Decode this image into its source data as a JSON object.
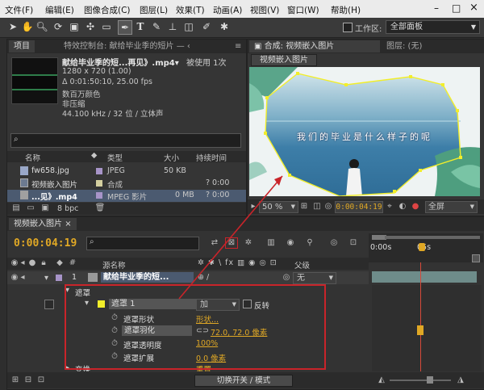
{
  "menu": [
    "文件(F)",
    "编辑(E)",
    "图像合成(C)",
    "图层(L)",
    "效果(T)",
    "动画(A)",
    "视图(V)",
    "窗口(W)",
    "帮助(H)"
  ],
  "window_controls": {
    "minimize": "–",
    "maximize": "□",
    "close": "×"
  },
  "toolbar": {
    "workspace_label": "工作区:",
    "workspace_value": "全部面板"
  },
  "project_panel": {
    "tab_project": "项目",
    "tab_effects": "特效控制台: 献给毕业季的短片 — ‹",
    "file_title": "献给毕业季的短...再见》.mp4▾",
    "used_count": "被使用 1次",
    "resolution": "1280 x 720 (1.00)",
    "duration": "Δ 0:01:50:10, 25.00 fps",
    "colors": "数百万颜色",
    "compression": "非压缩",
    "audio": "44.100 kHz / 32 位 / 立体声",
    "search_placeholder": "",
    "col_name": "名称",
    "col_type": "类型",
    "col_size": "大小",
    "col_duration": "持续时间",
    "items": [
      {
        "name": "fw658.jpg",
        "type": "JPEG",
        "size": "50 KB",
        "duration": ""
      },
      {
        "name": "视频嵌入图片",
        "type": "合成",
        "size": "",
        "duration": "? 0:00"
      },
      {
        "name": "...见》.mp4",
        "type": "MPEG 影片",
        "size": "0 MB",
        "duration": "? 0:00"
      }
    ],
    "bpc": "8 bpc"
  },
  "composition_panel": {
    "tab_comp": "合成: 视频嵌入图片",
    "tab_layer": "图层: (无)",
    "subtab": "视频嵌入图片",
    "caption": "我们的毕业是什么样子的呢",
    "zoom": "50 %",
    "timecode": "0:00:04:19",
    "quality": "全屏"
  },
  "timeline": {
    "tab": "视频嵌入图片",
    "timecode": "0:00:04:19",
    "search_placeholder": "",
    "col_source": "源名称",
    "col_parent": "父级",
    "ruler_start": "0:00s",
    "ruler_mid": "05s",
    "layer_num": "1",
    "layer_name": "献给毕业季的短...",
    "parent_value": "无",
    "masks_group": "遮罩",
    "mask_name": "遮罩 1",
    "mask_mode": "加",
    "invert_label": "反转",
    "props": [
      {
        "name": "遮罩形状",
        "value": "形状..."
      },
      {
        "name": "遮罩羽化",
        "value": "72.0, 72.0 像素"
      },
      {
        "name": "遮罩透明度",
        "value": "100%"
      },
      {
        "name": "遮罩扩展",
        "value": "0.0 像素"
      }
    ],
    "next_group": "变换",
    "next_value": "重置",
    "toggle_label": "切换开关 / 模式"
  },
  "colors": {
    "accent_yellow": "#e0a825",
    "annotation_red": "#c9242a",
    "mask_path": "#f2ee2a"
  }
}
